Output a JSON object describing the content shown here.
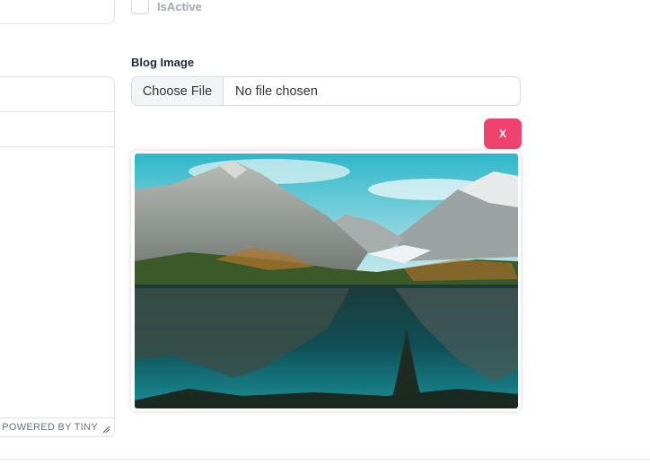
{
  "form": {
    "isactive_label": "IsActive",
    "blog_image_label": "Blog Image",
    "file_input": {
      "button_label": "Choose File",
      "status_text": "No file chosen"
    },
    "remove_button_label": "X"
  },
  "editor": {
    "powered_by": "POWERED BY TINY"
  },
  "colors": {
    "remove_button": "#f0426e",
    "label_text": "#1f2937",
    "muted_label": "#a3a7b3"
  }
}
